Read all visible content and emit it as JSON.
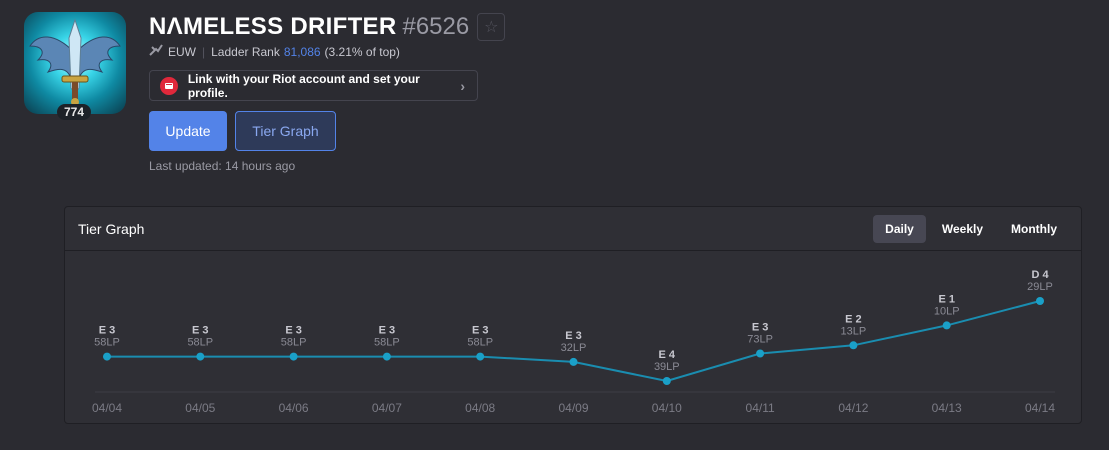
{
  "profile": {
    "level": "774",
    "game_name": "NΛMELESS DRIFTER",
    "tag": "#6526",
    "region": "EUW",
    "ladder_label": "Ladder Rank",
    "ladder_rank": "81,086",
    "ladder_pct": "(3.21% of top)",
    "riot_link_text": "Link with your Riot account and set your profile.",
    "last_updated": "Last updated: 14 hours ago"
  },
  "buttons": {
    "update": "Update",
    "tier_graph": "Tier Graph"
  },
  "panel": {
    "title": "Tier Graph",
    "tabs": [
      "Daily",
      "Weekly",
      "Monthly"
    ],
    "active_tab": "Daily"
  },
  "colors": {
    "accent": "#5383e8",
    "line": "#1a8db0",
    "point": "#1aa0c8",
    "riot_red": "#e0283b"
  },
  "chart_data": {
    "type": "line",
    "title": "",
    "xlabel": "",
    "ylabel": "",
    "categories": [
      "04/04",
      "04/05",
      "04/06",
      "04/07",
      "04/08",
      "04/09",
      "04/10",
      "04/11",
      "04/12",
      "04/13",
      "04/14"
    ],
    "series": [
      {
        "tiers": [
          "E 3",
          "E 3",
          "E 3",
          "E 3",
          "E 3",
          "E 3",
          "E 4",
          "E 3",
          "E 2",
          "E 1",
          "D 4"
        ],
        "lp": [
          "58LP",
          "58LP",
          "58LP",
          "58LP",
          "58LP",
          "32LP",
          "39LP",
          "73LP",
          "13LP",
          "10LP",
          "29LP"
        ],
        "values": [
          358,
          358,
          358,
          358,
          358,
          332,
          239,
          373,
          413,
          510,
          629
        ]
      }
    ]
  }
}
